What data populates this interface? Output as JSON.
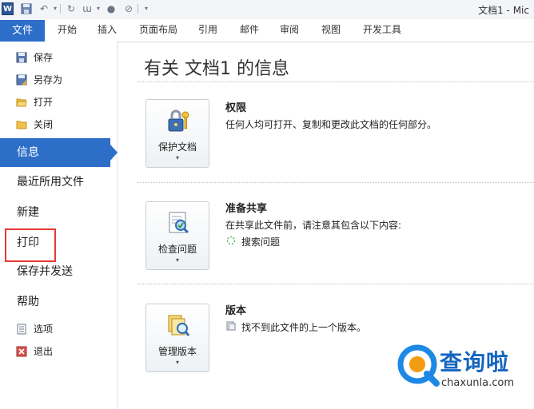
{
  "titlebar": {
    "app_icon_letter": "W",
    "title": "文档1 - Mic"
  },
  "ribbon": {
    "file_tab": "文件",
    "tabs": [
      "开始",
      "插入",
      "页面布局",
      "引用",
      "邮件",
      "审阅",
      "视图",
      "开发工具"
    ]
  },
  "nav": {
    "save": "保存",
    "save_as": "另存为",
    "open": "打开",
    "close": "关闭",
    "info": "信息",
    "recent": "最近所用文件",
    "new": "新建",
    "print": "打印",
    "save_send": "保存并发送",
    "help": "帮助",
    "options": "选项",
    "exit": "退出"
  },
  "info": {
    "title": "有关 文档1 的信息",
    "permissions": {
      "button": "保护文档",
      "title": "权限",
      "desc": "任何人均可打开、复制和更改此文档的任何部分。"
    },
    "prepare": {
      "button": "检查问题",
      "title": "准备共享",
      "desc": "在共享此文件前，请注意其包含以下内容:",
      "item": "搜索问题"
    },
    "versions": {
      "button": "管理版本",
      "title": "版本",
      "item": "找不到此文件的上一个版本。"
    }
  },
  "watermark": {
    "brand": "查询啦",
    "url": "chaxunla.com"
  },
  "colors": {
    "accent": "#2d6ec9",
    "highlight": "#e53935",
    "watermark_blue": "#1e88e5",
    "watermark_orange": "#f39c12"
  }
}
